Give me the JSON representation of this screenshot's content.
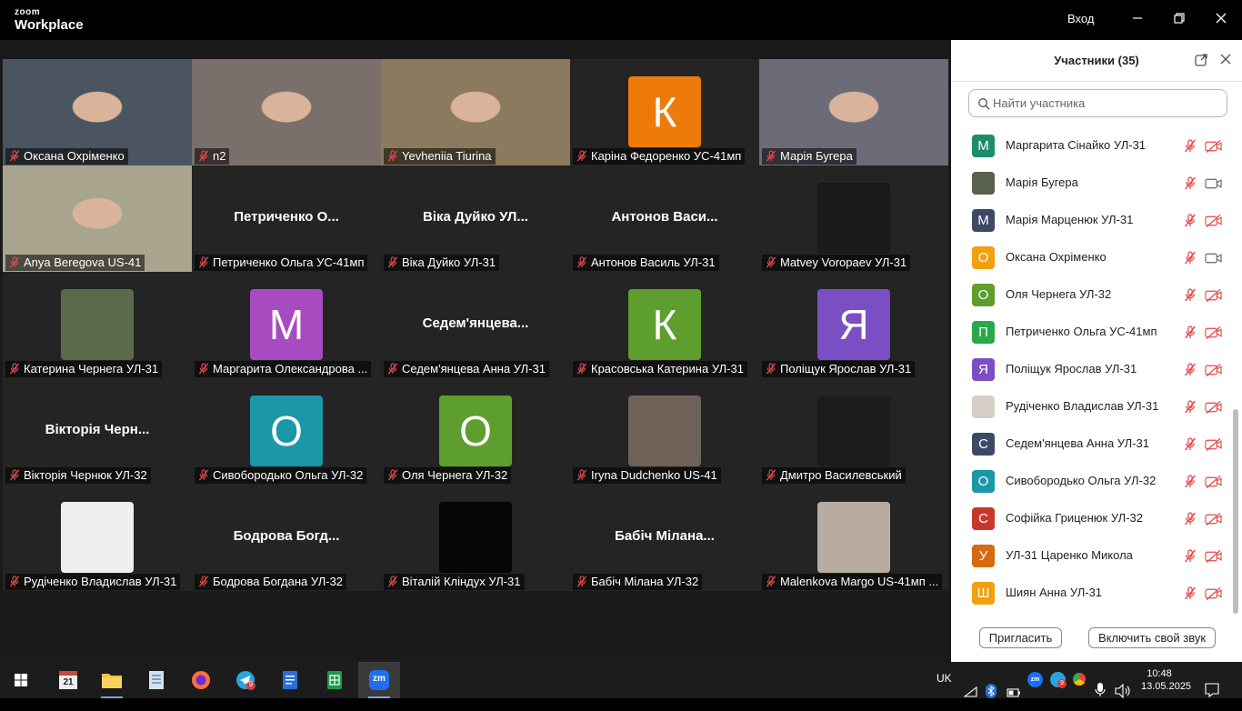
{
  "app": {
    "logo_top": "zoom",
    "logo_bottom": "Workplace",
    "login": "Вход"
  },
  "window_controls": {
    "minimize": "minimize-icon",
    "restore": "restore-icon",
    "close": "close-icon"
  },
  "tiles": [
    {
      "label": "Оксана Охріменко",
      "kind": "video",
      "bg": "#4a5560"
    },
    {
      "label": "n2",
      "kind": "video",
      "bg": "#7a6f6a"
    },
    {
      "label": "Yevheniia Tiurina",
      "kind": "video",
      "bg": "#8b7a5e",
      "active": true
    },
    {
      "label": "Каріна Федоренко УС-41мп",
      "kind": "avatar",
      "letter": "К",
      "color": "#ee7a0a"
    },
    {
      "label": "Марія Бугера",
      "kind": "video",
      "bg": "#6c6c78"
    },
    {
      "label": "Anya Beregova US-41",
      "kind": "video",
      "bg": "#a8a48e"
    },
    {
      "label": "Петриченко Ольга УС-41мп",
      "kind": "name",
      "big": "Петриченко О..."
    },
    {
      "label": "Віка Дуйко УЛ-31",
      "kind": "name",
      "big": "Віка Дуйко УЛ..."
    },
    {
      "label": "Антонов Василь УЛ-31",
      "kind": "name",
      "big": "Антонов Васи..."
    },
    {
      "label": "Matvey Voropaev УЛ-31",
      "kind": "photo",
      "bg": "#1a1a1a"
    },
    {
      "label": "Катерина Чернега УЛ-31",
      "kind": "photo",
      "bg": "#5a6a4a"
    },
    {
      "label": "Маргарита Олександрова ...",
      "kind": "avatar",
      "letter": "М",
      "color": "#a64cc0"
    },
    {
      "label": "Седем'янцева Анна УЛ-31",
      "kind": "name",
      "big": "Седем'янцева..."
    },
    {
      "label": "Красовська Катерина УЛ-31",
      "kind": "avatar",
      "letter": "К",
      "color": "#5e9e2e"
    },
    {
      "label": "Поліщук Ярослав УЛ-31",
      "kind": "avatar",
      "letter": "Я",
      "color": "#7b4fc4"
    },
    {
      "label": "Вікторія Чернюк УЛ-32",
      "kind": "name",
      "big": "Вікторія Черн..."
    },
    {
      "label": "Сивобородько Ольга УЛ-32",
      "kind": "avatar",
      "letter": "О",
      "color": "#1a98a8"
    },
    {
      "label": "Оля Чернега УЛ-32",
      "kind": "avatar",
      "letter": "О",
      "color": "#5e9e2e"
    },
    {
      "label": "Iryna Dudchenko US-41",
      "kind": "photo",
      "bg": "#6e6258"
    },
    {
      "label": "Дмитро Василевський",
      "kind": "photo",
      "bg": "#1c1c1c"
    },
    {
      "label": "Рудіченко Владислав УЛ-31",
      "kind": "photo",
      "bg": "#efefef"
    },
    {
      "label": "Бодрова Богдана УЛ-32",
      "kind": "name",
      "big": "Бодрова Богд..."
    },
    {
      "label": "Віталій Кліндух УЛ-31",
      "kind": "photo",
      "bg": "#050505"
    },
    {
      "label": "Бабіч Мілана УЛ-32",
      "kind": "name",
      "big": "Бабіч Мілана..."
    },
    {
      "label": "Malenkova Margo US-41мп ...",
      "kind": "photo",
      "bg": "#b8aca0"
    }
  ],
  "panel": {
    "title": "Участники (35)",
    "popout_icon": "popout-icon",
    "close_icon": "close-icon",
    "search_placeholder": "Найти участника",
    "participants": [
      {
        "name": "Маргарита Сінайко УЛ-31",
        "letter": "М",
        "color": "#1e8e6a",
        "cam": "off"
      },
      {
        "name": "Марія Бугера",
        "letter": "",
        "color": "#5a6050",
        "cam": "on"
      },
      {
        "name": "Марія Марценюк УЛ-31",
        "letter": "М",
        "color": "#3d4a66",
        "cam": "off"
      },
      {
        "name": "Оксана Охріменко",
        "letter": "О",
        "color": "#f0a010",
        "cam": "on"
      },
      {
        "name": "Оля Чернега УЛ-32",
        "letter": "О",
        "color": "#5e9e2e",
        "cam": "off"
      },
      {
        "name": "Петриченко Ольга УС-41мп",
        "letter": "П",
        "color": "#2aa84a",
        "cam": "off"
      },
      {
        "name": "Поліщук Ярослав УЛ-31",
        "letter": "Я",
        "color": "#7b4fc4",
        "cam": "off"
      },
      {
        "name": "Рудіченко Владислав УЛ-31",
        "letter": "",
        "color": "#d8cfc8",
        "cam": "off"
      },
      {
        "name": "Седем'янцева Анна УЛ-31",
        "letter": "С",
        "color": "#3d4a66",
        "cam": "off"
      },
      {
        "name": "Сивобородько Ольга УЛ-32",
        "letter": "О",
        "color": "#1a98a8",
        "cam": "off"
      },
      {
        "name": "Софійка Гриценюк УЛ-32",
        "letter": "С",
        "color": "#c8382a",
        "cam": "off"
      },
      {
        "name": "УЛ-31 Царенко Микола",
        "letter": "У",
        "color": "#d66a10",
        "cam": "off"
      },
      {
        "name": "Шиян Анна УЛ-31",
        "letter": "Ш",
        "color": "#f0a010",
        "cam": "off"
      }
    ],
    "invite_button": "Пригласить",
    "unmute_button": "Включить свой звук"
  },
  "taskbar": {
    "apps": [
      "start-icon",
      "calendar-app-icon",
      "file-explorer-icon",
      "notepad-icon",
      "firefox-icon",
      "telegram-icon",
      "docs-icon",
      "sheets-icon",
      "zoom-icon"
    ],
    "calendar_day": "21",
    "telegram_badge": "9",
    "zoom_label": "zm",
    "tray_zoom_label": "zm",
    "tray_badge": "9",
    "lang": "UK",
    "time": "10:48",
    "date": "13.05.2025"
  }
}
